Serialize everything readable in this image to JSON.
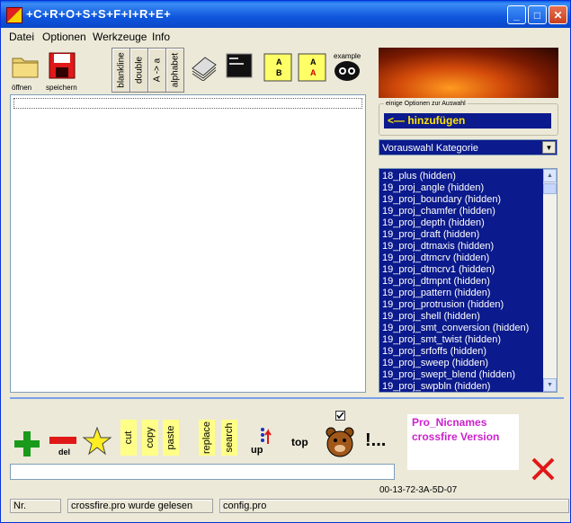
{
  "window": {
    "title": "+C+R+O+S+S+F+I+R+E+",
    "controls": [
      "_",
      "□",
      "✕"
    ]
  },
  "menu": [
    "Datei",
    "Optionen",
    "Werkzeuge",
    "Info"
  ],
  "toolbar": {
    "open_label": "öffnen",
    "save_label": "speichern",
    "blankline": "blankline",
    "double": "double",
    "sort": "A -> a",
    "alphabet": "alphabet",
    "example": "example"
  },
  "right_panel": {
    "group_title": "einige Optionen zur Auswahl",
    "add_button": "<— hinzufügen",
    "category_select": "Vorauswahl Kategorie",
    "list_items": [
      "18_plus (hidden)",
      "19_proj_angle (hidden)",
      "19_proj_boundary (hidden)",
      "19_proj_chamfer (hidden)",
      "19_proj_depth (hidden)",
      "19_proj_draft (hidden)",
      "19_proj_dtmaxis (hidden)",
      "19_proj_dtmcrv (hidden)",
      "19_proj_dtmcrv1 (hidden)",
      "19_proj_dtmpnt (hidden)",
      "19_proj_pattern (hidden)",
      "19_proj_protrusion (hidden)",
      "19_proj_shell (hidden)",
      "19_proj_smt_conversion (hidden)",
      "19_proj_smt_twist (hidden)",
      "19_proj_srfoffs (hidden)",
      "19_proj_sweep (hidden)",
      "19_proj_swept_blend (hidden)",
      "19_proj_swpbln (hidden)"
    ]
  },
  "bottom_toolbar": {
    "del_label": "del",
    "cut": "cut",
    "copy": "copy",
    "paste": "paste",
    "replace": "replace",
    "search": "search",
    "up": "up",
    "top": "top",
    "exclam": "!..."
  },
  "pro_box": {
    "line1": "Pro_Nicnames",
    "line2": "crossfire Version"
  },
  "mac_address": "00-13-72-3A-5D-07",
  "status": {
    "nr": "Nr.",
    "message": "crossfire.pro wurde gelesen",
    "config": "config.pro"
  },
  "colors": {
    "list_bg": "#0b1a8c",
    "accent_yellow": "#ffe400",
    "pro_text": "#cc22cc"
  }
}
